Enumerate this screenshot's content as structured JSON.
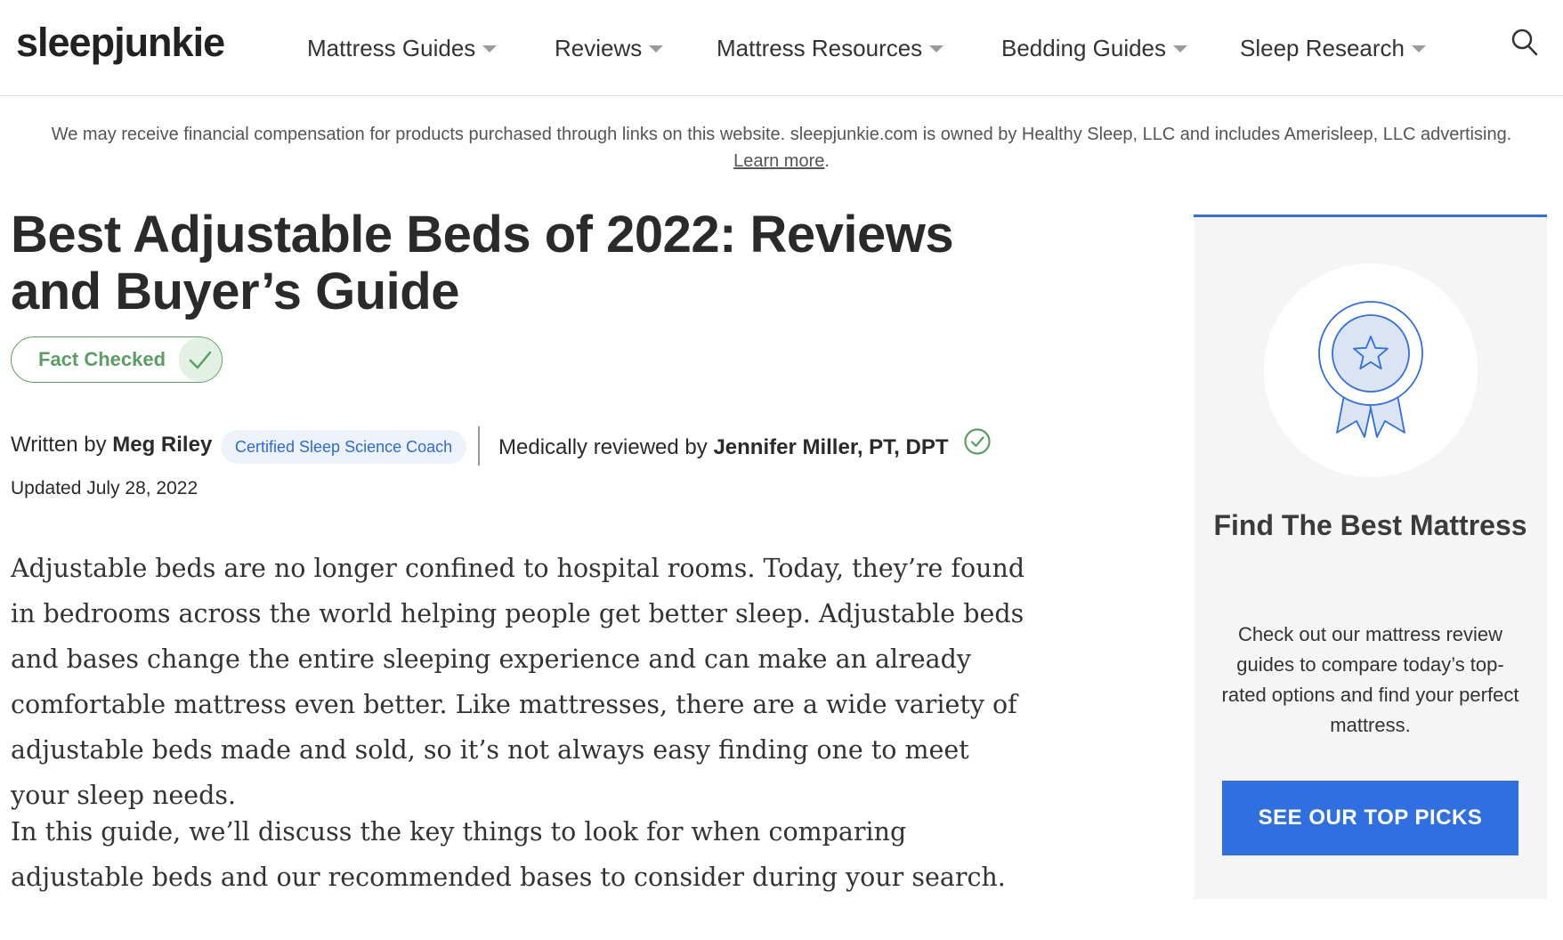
{
  "header": {
    "logo": "sleepjunkie",
    "nav": [
      {
        "label": "Mattress Guides"
      },
      {
        "label": "Reviews"
      },
      {
        "label": "Mattress Resources"
      },
      {
        "label": "Bedding Guides"
      },
      {
        "label": "Sleep Research"
      }
    ],
    "search_icon": "search-icon"
  },
  "disclosure": {
    "text": "We may receive financial compensation for products purchased through links on this website. sleepjunkie.com is owned by Healthy Sleep, LLC and includes Amerisleep, LLC advertising.",
    "link": "Learn more",
    "end": "."
  },
  "article": {
    "title": "Best Adjustable Beds of 2022: Reviews and Buyer’s Guide",
    "fact_checked": "Fact Checked",
    "written_by_prefix": "Written by",
    "author": "Meg Riley",
    "author_badge": "Certified Sleep Science Coach",
    "reviewed_by_prefix": "Medically reviewed by",
    "reviewer": "Jennifer Miller, PT, DPT",
    "updated": "Updated July 28, 2022",
    "paragraphs": [
      "Adjustable beds are no longer confined to hospital rooms. Today, they’re found in bedrooms across the world helping people get better sleep. Adjustable beds and bases change the entire sleeping experience and can make an already comfortable mattress even better. Like mattresses, there are a wide variety of adjustable beds made and sold, so it’s not always easy finding one to meet your sleep needs.",
      "In this guide, we’ll discuss the key things to look for when comparing adjustable beds and our recommended bases to consider during your search."
    ]
  },
  "sidebar": {
    "title": "Find The Best Mattress",
    "text": "Check out our mattress review guides to compare today’s top-rated options and find your perfect mattress.",
    "button": "SEE OUR TOP PICKS"
  },
  "colors": {
    "accent_blue": "#2f6fe0",
    "fact_green": "#5a9e63",
    "badge_blue": "#2b6bd6"
  }
}
